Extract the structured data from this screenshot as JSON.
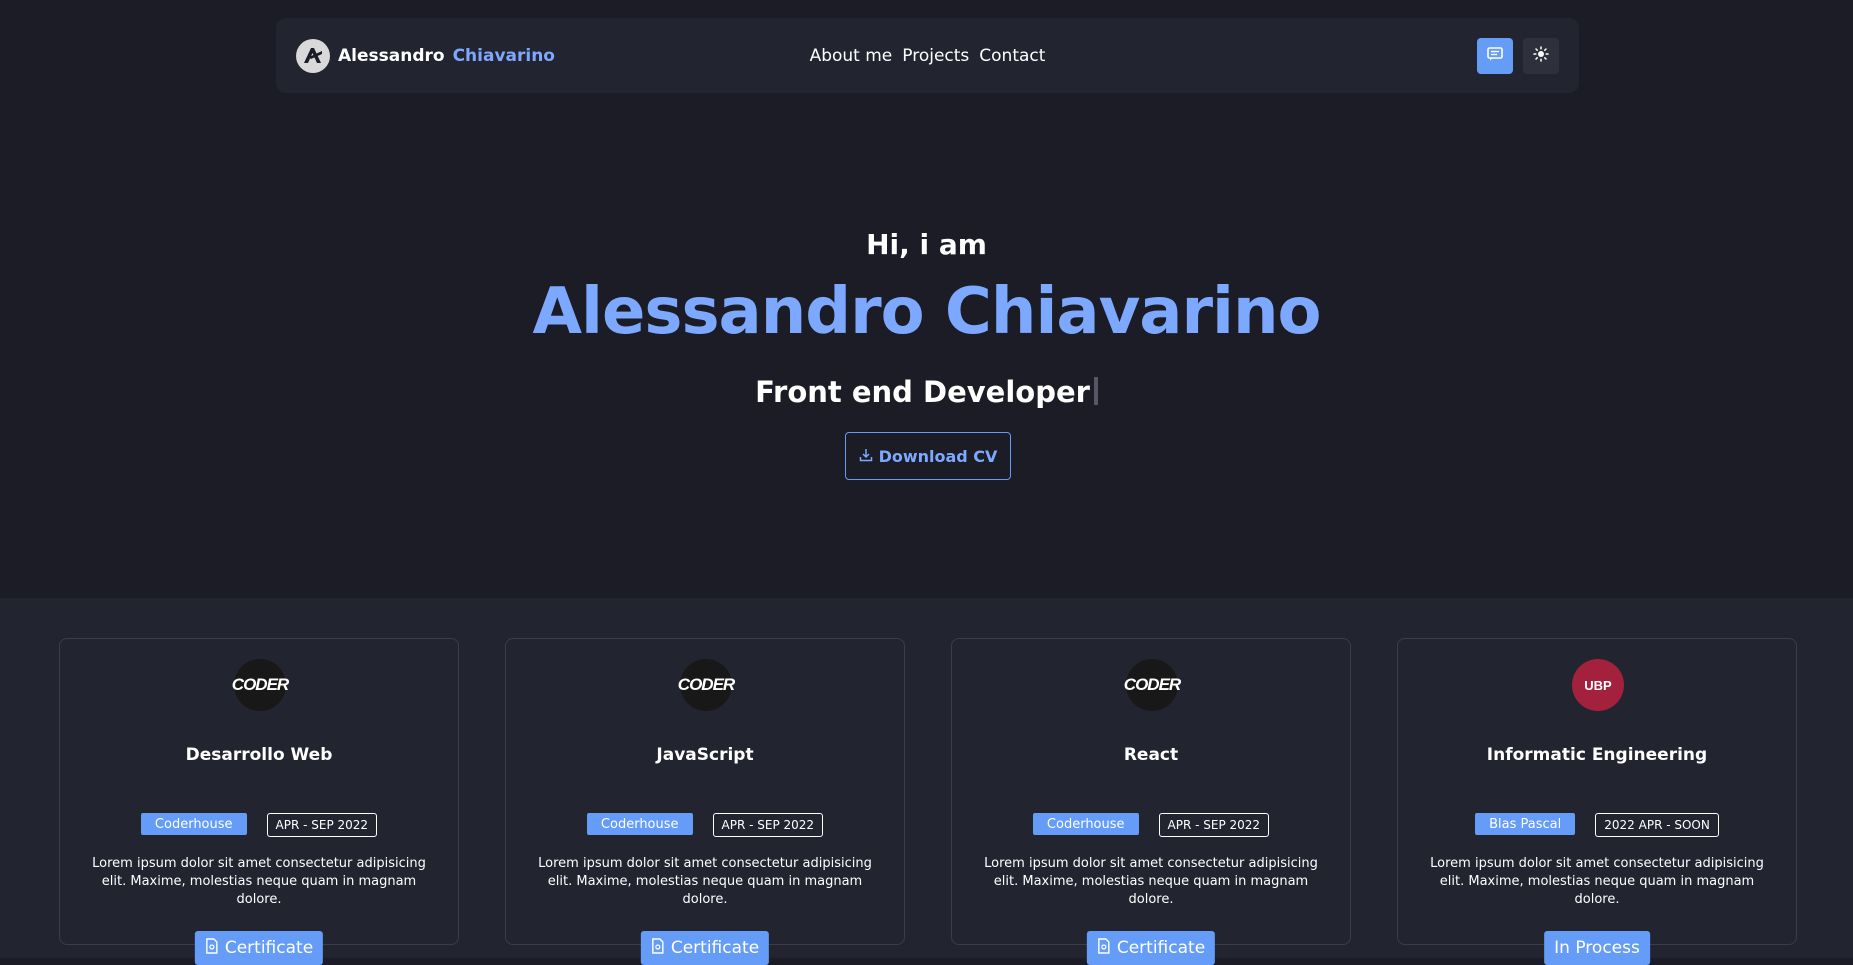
{
  "nav": {
    "brand_first": "Alessandro",
    "brand_last": "Chiavarino",
    "links": [
      "About me",
      "Projects",
      "Contact"
    ],
    "icons": [
      "message-icon",
      "sun-icon"
    ]
  },
  "hero": {
    "greeting": "Hi, i am",
    "name": "Alessandro Chiavarino",
    "role": "Front end Developer",
    "cv_label": "Download CV"
  },
  "cards": [
    {
      "logo": "CODER",
      "title": "Desarrollo Web",
      "school": "Coderhouse",
      "date": "APR - SEP 2022",
      "desc": "Lorem ipsum dolor sit amet consectetur adipisicing elit. Maxime, molestias neque quam in magnam dolore.",
      "button": "Certificate"
    },
    {
      "logo": "CODER",
      "title": "JavaScript",
      "school": "Coderhouse",
      "date": "APR - SEP 2022",
      "desc": "Lorem ipsum dolor sit amet consectetur adipisicing elit. Maxime, molestias neque quam in magnam dolore.",
      "button": "Certificate"
    },
    {
      "logo": "CODER",
      "title": "React",
      "school": "Coderhouse",
      "date": "APR - SEP 2022",
      "desc": "Lorem ipsum dolor sit amet consectetur adipisicing elit. Maxime, molestias neque quam in magnam dolore.",
      "button": "Certificate"
    },
    {
      "logo": "UBP",
      "title": "Informatic Engineering",
      "school": "Blas Pascal",
      "date": "2022 APR - SOON",
      "desc": "Lorem ipsum dolor sit amet consectetur adipisicing elit. Maxime, molestias neque quam in magnam dolore.",
      "button": "In Process"
    }
  ],
  "colors": {
    "accent": "#649cf8",
    "name": "#7da8ff",
    "background": "#1b1c25",
    "panel": "#222430",
    "ubp": "#a3213d"
  }
}
